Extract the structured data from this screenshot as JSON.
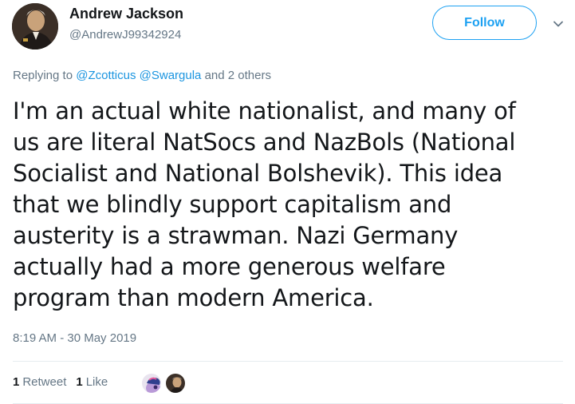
{
  "author": {
    "name": "Andrew Jackson",
    "handle": "@AndrewJ99342924"
  },
  "follow_label": "Follow",
  "replying": {
    "prefix": "Replying to",
    "mention1": "@Zcotticus",
    "mention2": "@Swargula",
    "suffix": "and 2 others"
  },
  "tweet_lines": [
    "I'm an actual white nationalist, and many of",
    "us are literal NatSocs and NazBols (National",
    "Socialist and National Bolshevik). This idea",
    "that we blindly support capitalism and",
    "austerity is a strawman. Nazi Germany",
    "actually had a more generous welfare",
    "program than modern America."
  ],
  "timestamp": "8:19 AM - 30 May 2019",
  "stats": {
    "retweets_count": "1",
    "retweets_label": "Retweet",
    "likes_count": "1",
    "likes_label": "Like"
  },
  "colors": {
    "accent": "#1da1f2",
    "link": "#1b95e0",
    "muted": "#657786",
    "text": "#14171a"
  },
  "icons": [
    "avatar-portrait",
    "chevron-down-icon",
    "liker-avatar-pony",
    "liker-avatar-portrait"
  ]
}
